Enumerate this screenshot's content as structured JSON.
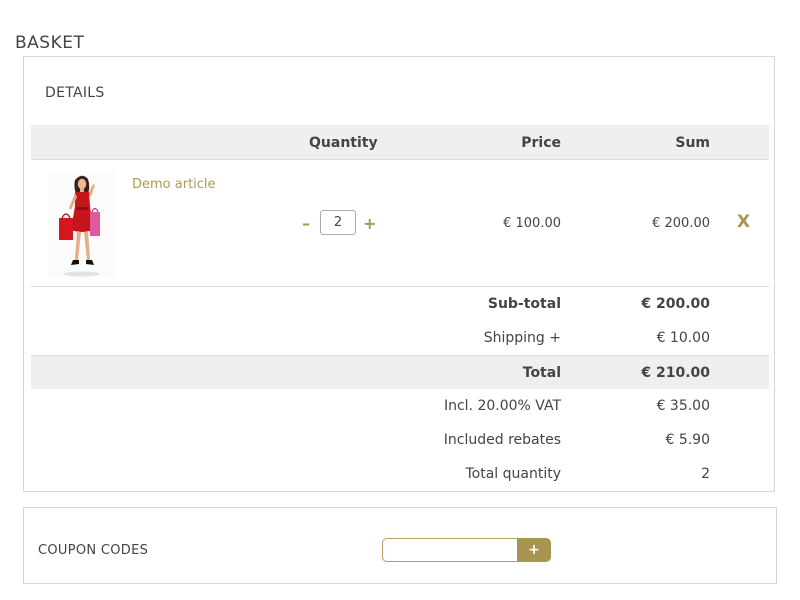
{
  "page": {
    "title": "BASKET"
  },
  "details": {
    "title": "DETAILS",
    "columns": {
      "quantity": "Quantity",
      "price": "Price",
      "sum": "Sum"
    },
    "items": [
      {
        "name": "Demo article",
        "quantity": "2",
        "minus": "–",
        "plus": "+",
        "price": "€ 100.00",
        "sum": "€ 200.00",
        "remove": "X",
        "image_icon": "product-photo-woman-red-dress"
      }
    ],
    "summary": {
      "subtotal_label": "Sub-total",
      "subtotal_value": "€ 200.00",
      "shipping_label": "Shipping +",
      "shipping_value": "€ 10.00",
      "total_label": "Total",
      "total_value": "€ 210.00",
      "vat_label": "Incl. 20.00% VAT",
      "vat_value": "€ 35.00",
      "rebates_label": "Included rebates",
      "rebates_value": "€ 5.90",
      "quantity_label": "Total quantity",
      "quantity_value": "2"
    }
  },
  "coupon": {
    "title": "COUPON CODES",
    "input_value": "",
    "input_placeholder": "",
    "add_label": "+"
  },
  "colors": {
    "accent": "#a8954f",
    "link": "#ad9a55",
    "header_bg": "#efefef",
    "border": "#d6d6d6"
  }
}
